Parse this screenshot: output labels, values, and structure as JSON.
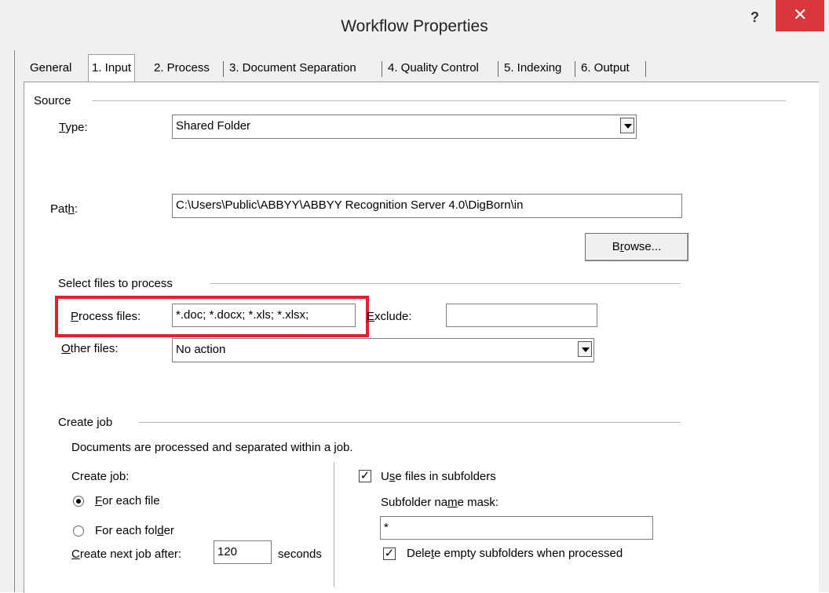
{
  "window": {
    "title": "Workflow Properties",
    "help_glyph": "?",
    "close_glyph": "✕"
  },
  "tabs": [
    {
      "label": "General"
    },
    {
      "label": "1. Input"
    },
    {
      "label": "2. Process"
    },
    {
      "label": "3. Document Separation"
    },
    {
      "label": "4. Quality Control"
    },
    {
      "label": "5. Indexing"
    },
    {
      "label": "6. Output"
    }
  ],
  "source": {
    "heading": "Source",
    "type_label_u": "T",
    "type_label_rest": "ype:",
    "type_value": "Shared Folder",
    "path_label_pre": "Pat",
    "path_label_u": "h",
    "path_label_post": ":",
    "path_value": "C:\\Users\\Public\\ABBYY\\ABBYY Recognition Server 4.0\\DigBorn\\in",
    "browse_pre": "B",
    "browse_u": "r",
    "browse_post": "owse..."
  },
  "select_files": {
    "heading": "Select files to process",
    "process_label_u": "P",
    "process_label_rest": "rocess files:",
    "process_value": "*.doc; *.docx; *.xls; *.xlsx;",
    "exclude_label_u": "E",
    "exclude_label_rest": "xclude:",
    "exclude_value": "",
    "other_label_u": "O",
    "other_label_rest": "ther files:",
    "other_value": "No action"
  },
  "create_job": {
    "heading": "Create job",
    "description": "Documents are processed and separated within a job.",
    "create_job_label": "Create job:",
    "radio_each_file_u": "F",
    "radio_each_file_rest": "or each file",
    "radio_each_folder_pre": "For each fol",
    "radio_each_folder_u": "d",
    "radio_each_folder_post": "er",
    "next_job_u": "C",
    "next_job_rest": "reate next job after:",
    "next_job_value": "120",
    "seconds_label": "seconds",
    "use_subfolders_pre": "U",
    "use_subfolders_u": "s",
    "use_subfolders_post": "e files in subfolders",
    "use_subfolders_checked": "✓",
    "mask_label_pre": "Subfolder na",
    "mask_label_u": "m",
    "mask_label_post": "e mask:",
    "mask_value": "*",
    "delete_empty_pre": "Dele",
    "delete_empty_u": "t",
    "delete_empty_post": "e empty subfolders when processed",
    "delete_empty_checked": "✓"
  },
  "colors": {
    "close_button": "#d9363e",
    "highlight_box": "#e3202b"
  }
}
